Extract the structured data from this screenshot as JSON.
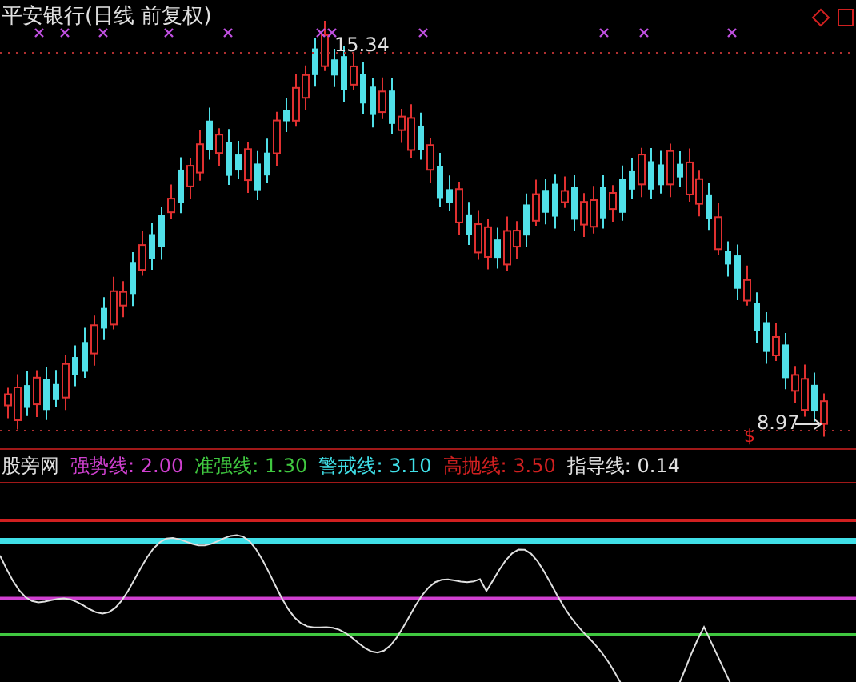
{
  "title": "平安银行(日线 前复权)",
  "price_chart": {
    "high_label": "15.34",
    "low_label": "8.97",
    "signal_mark": "$"
  },
  "legend": {
    "name": "股旁网",
    "items": [
      {
        "name": "强势线:",
        "value": "2.00",
        "color": "#d040d0"
      },
      {
        "name": "准强线:",
        "value": "1.30",
        "color": "#40c840"
      },
      {
        "name": "警戒线:",
        "value": "3.10",
        "color": "#40e0e8"
      },
      {
        "name": "高抛线:",
        "value": "3.50",
        "color": "#d02020"
      },
      {
        "name": "指导线:",
        "value": "0.14",
        "color": "#e0e0e0"
      }
    ]
  }
}
